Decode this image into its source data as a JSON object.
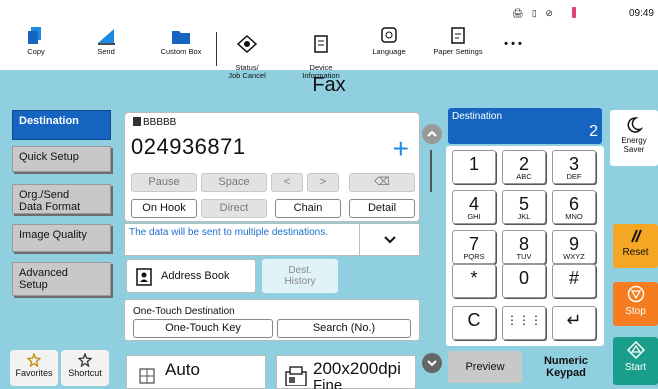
{
  "status": {
    "time": "09:49",
    "icons": "🖨 ▯ ⊘"
  },
  "toolbar": {
    "copy": "Copy",
    "send": "Send",
    "custom_box": "Custom Box",
    "status_job_cancel": "Status/\nJob Cancel",
    "device_information": "Device\nInformation",
    "language": "Language",
    "paper_settings": "Paper Settings",
    "more": "• • •"
  },
  "title": "Fax",
  "nav": {
    "destination": "Destination",
    "quick_setup": "Quick Setup",
    "org_send": "Org./Send\nData Format",
    "image_quality": "Image Quality",
    "advanced_setup": "Advanced\nSetup"
  },
  "favorites": {
    "favorites": "Favorites",
    "shortcut": "Shortcut"
  },
  "destination_panel": {
    "name": "BBBBB",
    "number": "024936871",
    "add": "+",
    "pause": "Pause",
    "space": "Space",
    "left": "<",
    "right": ">",
    "backspace": "⌫",
    "on_hook": "On Hook",
    "direct": "Direct",
    "chain": "Chain",
    "detail": "Detail"
  },
  "info": {
    "message": "The data will be sent to multiple destinations.",
    "chevron": "⌄"
  },
  "address_book": "Address Book",
  "dest_history": "Dest.\nHistory",
  "one_touch": {
    "label": "One-Touch Destination",
    "key": "One-Touch Key",
    "search": "Search (No.)"
  },
  "settings": {
    "color_mode": "Auto",
    "resolution": "200x200dpi",
    "resolution_sub": "Fine"
  },
  "dest_count": {
    "label": "Destination",
    "count": "2"
  },
  "keypad": {
    "keys": [
      {
        "d": "1",
        "s": ""
      },
      {
        "d": "2",
        "s": "ABC"
      },
      {
        "d": "3",
        "s": "DEF"
      },
      {
        "d": "4",
        "s": "GHI"
      },
      {
        "d": "5",
        "s": "JKL"
      },
      {
        "d": "6",
        "s": "MNO"
      },
      {
        "d": "7",
        "s": "PQRS"
      },
      {
        "d": "8",
        "s": "TUV"
      },
      {
        "d": "9",
        "s": "WXYZ"
      },
      {
        "d": "*",
        "s": ""
      },
      {
        "d": "0",
        "s": ""
      },
      {
        "d": "#",
        "s": ""
      },
      {
        "d": "C",
        "s": ""
      },
      {
        "d": "⋮⋮⋮",
        "s": ""
      },
      {
        "d": "↵",
        "s": ""
      }
    ]
  },
  "preview": "Preview",
  "numeric_keypad": "Numeric\nKeypad",
  "side": {
    "energy_saver": "Energy Saver",
    "reset": "Reset",
    "stop": "Stop",
    "start": "Start"
  },
  "colors": {
    "accent_blue": "#1565c0",
    "background": "#8fcfdf",
    "reset": "#f5a623",
    "stop": "#f57c1f",
    "start": "#1a9e8c"
  }
}
